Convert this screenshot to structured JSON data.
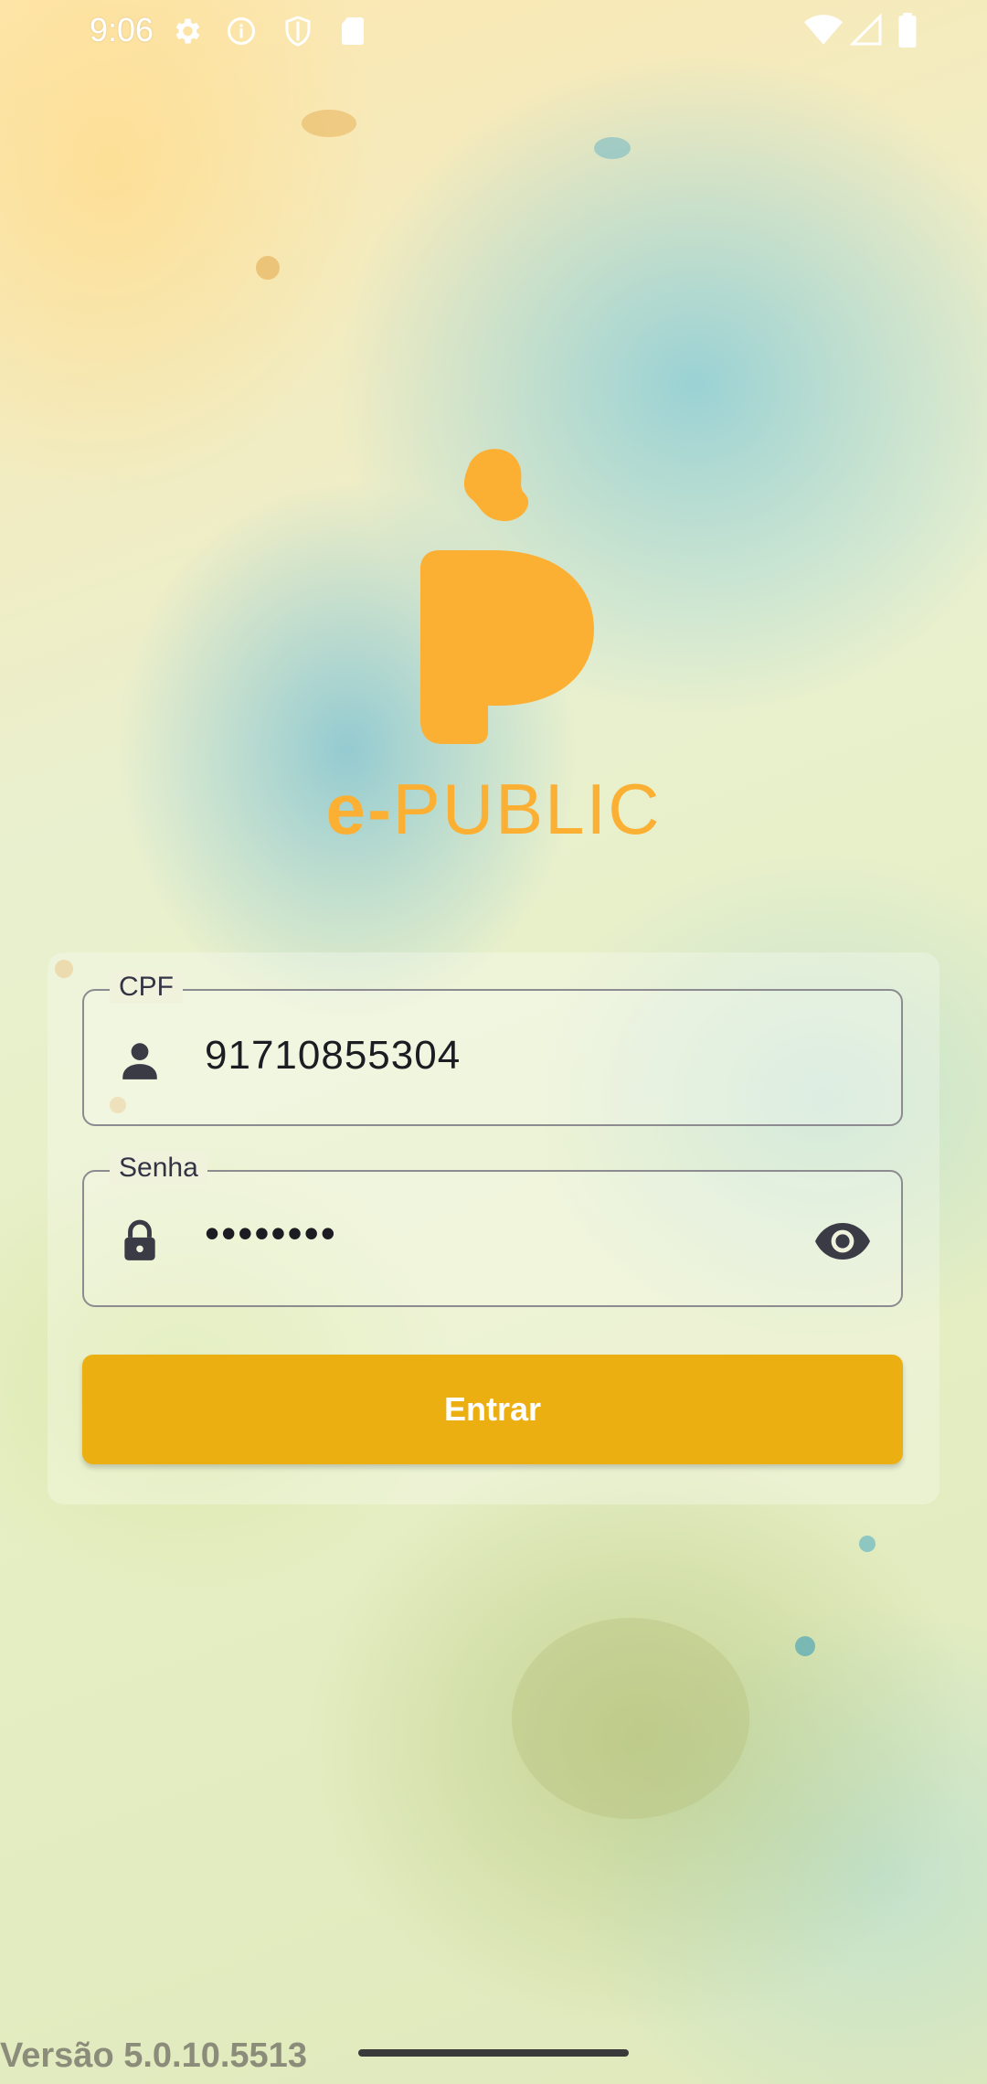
{
  "status_bar": {
    "time": "9:06",
    "icons_left": [
      "settings-icon",
      "info-icon",
      "shield-icon",
      "sd-card-icon"
    ],
    "icons_right": [
      "wifi-icon",
      "cellular-signal-icon",
      "battery-icon"
    ]
  },
  "brand": {
    "name_prefix": "e-",
    "name_main": "PUBLIC",
    "color": "#fbb034"
  },
  "login_form": {
    "cpf": {
      "label": "CPF",
      "value": "91710855304",
      "icon": "person-icon"
    },
    "password": {
      "label": "Senha",
      "value": "••••••••",
      "icon": "lock-icon",
      "toggle_icon": "eye-icon"
    },
    "submit_label": "Entrar",
    "submit_color": "#ecaf12"
  },
  "footer": {
    "version": "Versão 5.0.10.5513"
  }
}
